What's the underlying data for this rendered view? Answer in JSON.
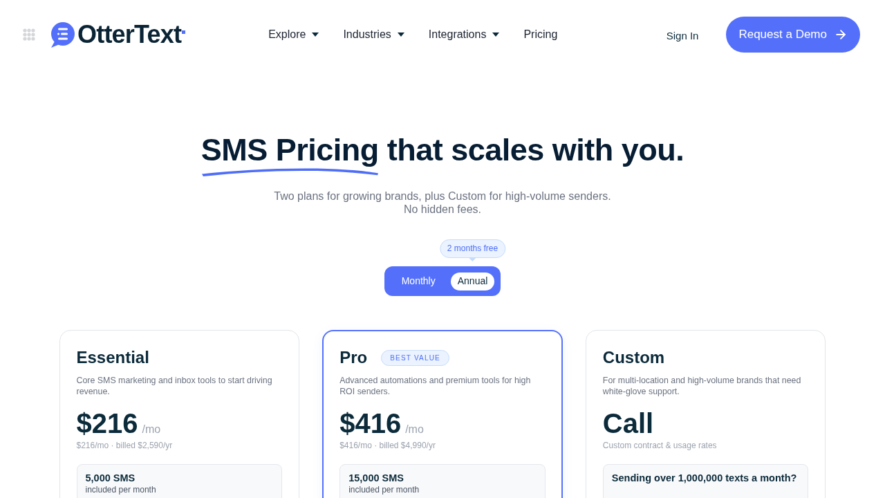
{
  "nav": {
    "brand": "OtterText",
    "items": [
      {
        "label": "Explore",
        "dropdown": true
      },
      {
        "label": "Industries",
        "dropdown": true
      },
      {
        "label": "Integrations",
        "dropdown": true
      },
      {
        "label": "Pricing",
        "dropdown": false
      }
    ],
    "sign_in": "Sign In",
    "cta": "Request a Demo"
  },
  "hero": {
    "heading_highlight": "SMS Pricing",
    "heading_rest": "that scales with you.",
    "subtitle_lines": [
      "Two plans for growing brands, plus Custom for high-volume senders.",
      "No hidden fees."
    ]
  },
  "billing": {
    "options": [
      {
        "label": "Monthly",
        "selected": false
      },
      {
        "label": "Annual",
        "selected": true,
        "badge": "2 months free"
      }
    ]
  },
  "plans": [
    {
      "name": "Essential",
      "featured": false,
      "description": "Core SMS marketing and inbox tools to start driving revenue.",
      "price": "$216",
      "period": "/mo",
      "billing_note": "$216/mo · billed $2,590/yr",
      "allowance": {
        "title": "5,000 SMS",
        "note": "included per month"
      }
    },
    {
      "name": "Pro",
      "badge": "BEST VALUE",
      "featured": true,
      "description": "Advanced automations and premium tools for high ROI senders.",
      "price": "$416",
      "period": "/mo",
      "billing_note": "$416/mo · billed $4,990/yr",
      "allowance": {
        "title": "15,000 SMS",
        "note": "included per month"
      }
    },
    {
      "name": "Custom",
      "featured": false,
      "description": "For multi-location and high-volume brands that need white-glove support.",
      "price": "Call",
      "billing_note": "Custom contract & usage rates",
      "allowance": {
        "title": "Sending over 1,000,000 texts a month?"
      }
    }
  ]
}
